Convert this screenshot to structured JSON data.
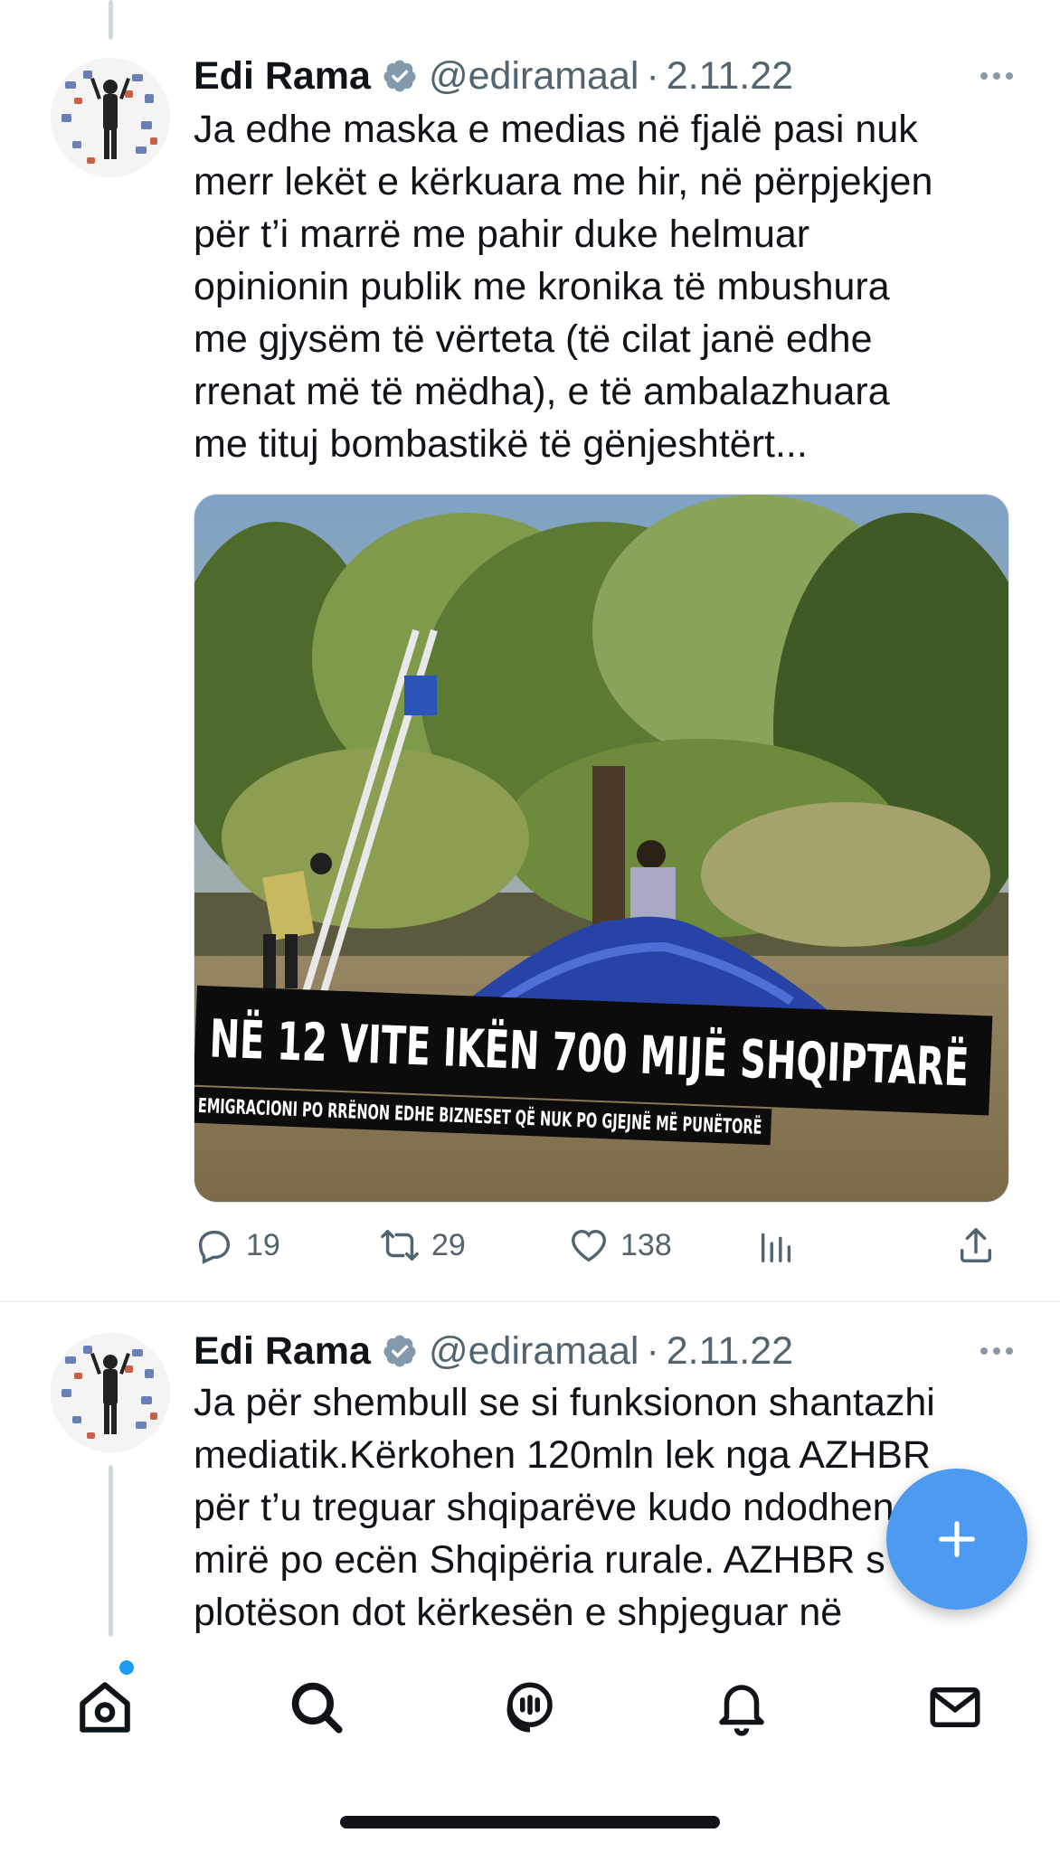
{
  "tweets": [
    {
      "name": "Edi Rama",
      "handle": "@ediramaal",
      "separator": "·",
      "date": "2.11.22",
      "text": "Ja edhe maska e medias në fjalë pasi nuk\nmerr lekët e kërkuara me hir, në përpjekjen\npër t’i marrë me pahir duke helmuar\nopinionin publik me kronika të mbushura\nme gjysëm të vërteta (të cilat janë edhe\nrrenat më të mëdha), e të ambalazhuara\nme tituj bombastikë të gënjeshtërt...",
      "media": {
        "headline": "NË 12 VITE IKËN 700 MIJË SHQIPTARË",
        "subheadline": "EMIGRACIONI PO RRËNON EDHE BIZNESET QË NUK PO GJEJNË MË PUNËTORË"
      },
      "stats": {
        "replies": "19",
        "retweets": "29",
        "likes": "138"
      }
    },
    {
      "name": "Edi Rama",
      "handle": "@ediramaal",
      "separator": "·",
      "date": "2.11.22",
      "text": "Ja për shembull se si funksionon shantazhi\nmediatik.Kërkohen 120mln lek nga AZHBR\npër t’u treguar shqiparëve kudo ndodhen\nmirë po ecën Shqipëria rurale. AZHBR s’e\nplotëson dot kërkesën e shpjeguar në"
    }
  ],
  "icons": {
    "verified": "verified-badge-icon",
    "more": "more-icon",
    "reply": "reply-icon",
    "retweet": "retweet-icon",
    "like": "heart-icon",
    "views": "views-icon",
    "share": "share-icon",
    "compose": "plus-icon",
    "tabs": [
      "home-icon",
      "search-icon",
      "spaces-icon",
      "bell-icon",
      "mail-icon"
    ]
  },
  "colors": {
    "accent": "#1d9bf0",
    "fab": "#4c9bf0",
    "muted": "#536471"
  }
}
